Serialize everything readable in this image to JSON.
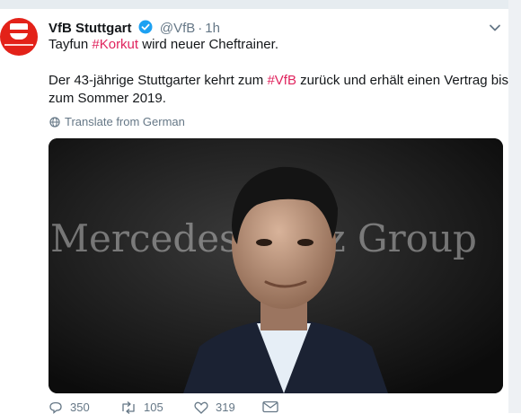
{
  "tweet": {
    "display_name": "VfB Stuttgart",
    "handle": "@VfB",
    "separator": "·",
    "time": "1h",
    "line1_before": "Tayfun ",
    "hashtag1": "#Korkut",
    "line1_after": " wird neuer Cheftrainer.",
    "line2_before": "Der 43-jährige Stuttgarter kehrt zum ",
    "hashtag2": "#VfB",
    "line2_after": " zurück und erhält einen Vertrag bis",
    "line3": "zum Sommer 2019.",
    "translate_label": "Translate from German",
    "image_text": "Mercedes-Benz Group",
    "counts": {
      "replies": "350",
      "retweets": "105",
      "likes": "319"
    }
  },
  "colors": {
    "brand_red": "#e32219",
    "hashtag": "#e0245e",
    "verified_blue": "#1da1f2",
    "muted": "#657786"
  }
}
